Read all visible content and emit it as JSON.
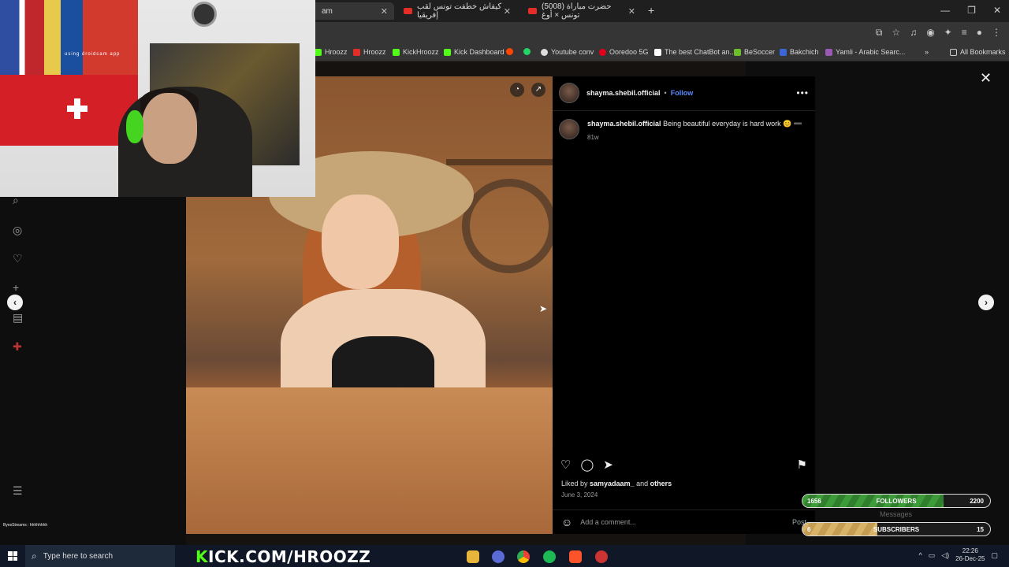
{
  "browser": {
    "tabs": [
      {
        "label": "am",
        "active": true
      },
      {
        "label": "كيفاش خطفت تونس لقب إفريقيا",
        "active": false
      },
      {
        "label": "(5008) حضرت مباراة تونس × أوغ",
        "active": false
      }
    ],
    "bookmarks": [
      {
        "label": "Hroozz",
        "color": "#53fc18"
      },
      {
        "label": "Hroozz",
        "color": "#e52d27"
      },
      {
        "label": "KickHroozz",
        "color": "#53fc18"
      },
      {
        "label": "Kick Dashboard",
        "color": "#53fc18"
      },
      {
        "label": "",
        "color": "#ff4500"
      },
      {
        "label": "",
        "color": "#25d366"
      },
      {
        "label": "Youtube conv",
        "color": "#dddddd"
      },
      {
        "label": "Ooredoo 5G",
        "color": "#e3001b"
      },
      {
        "label": "The best ChatBot an...",
        "color": "#ffffff"
      },
      {
        "label": "BeSoccer",
        "color": "#6bbf2a"
      },
      {
        "label": "Bakchich",
        "color": "#3a66d8"
      },
      {
        "label": "Yamli - Arabic Searc...",
        "color": "#9b59b6"
      }
    ],
    "all_bookmarks": "All Bookmarks"
  },
  "post": {
    "username": "shayma.shebil.official",
    "separator": "•",
    "follow": "Follow",
    "caption": "Being beautiful everyday is hard work 😊 ➖",
    "caption_age": "81w",
    "liked_by_prefix": "Liked by ",
    "liked_by_user": "samyadaam_",
    "liked_by_and": " and ",
    "liked_by_others": "others",
    "date": "June 3, 2024",
    "comment_placeholder": "Add a comment...",
    "post_button": "Post"
  },
  "overlays": {
    "webcam_caption": "using droidcam app",
    "followers": {
      "current": "1656",
      "label": "FOLLOWERS",
      "goal": "2200",
      "progress": 0.75
    },
    "subscribers": {
      "current": "6",
      "label": "SUBSCRIBERS",
      "goal": "15",
      "progress": 0.4
    },
    "messages": "Messages",
    "chat_line": "ByesStreams : hhhhhhhh",
    "kick_prefix": "K",
    "kick_url": "ICK.COM/HROOZZ"
  },
  "taskbar": {
    "search_placeholder": "Type here to search",
    "time": "22:26",
    "date": "26-Dec-25"
  },
  "icons": {
    "close": "✕",
    "prev": "‹",
    "next": "›",
    "more": "•••",
    "like": "♡",
    "comment": "◯",
    "share": "➤",
    "save": "⚑",
    "emoji": "☺",
    "newtab": "+",
    "search": "⌕"
  }
}
